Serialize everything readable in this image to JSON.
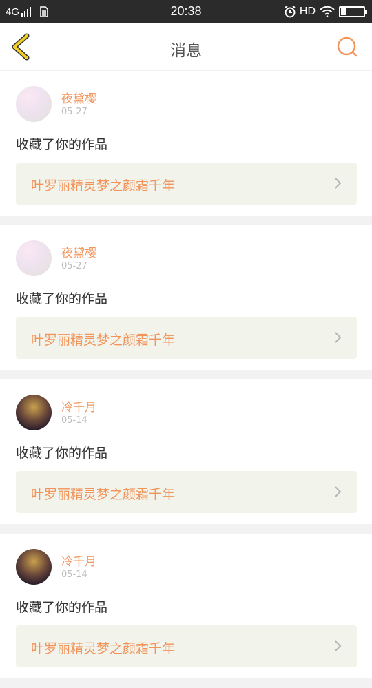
{
  "status_bar": {
    "network": "4G",
    "time": "20:38",
    "hd": "HD"
  },
  "nav": {
    "title": "消息"
  },
  "messages": [
    {
      "username": "夜黛樱",
      "date": "05-27",
      "action": "收藏了你的作品",
      "work_title": "叶罗丽精灵梦之颜霜千年",
      "avatar": "light"
    },
    {
      "username": "夜黛樱",
      "date": "05-27",
      "action": "收藏了你的作品",
      "work_title": "叶罗丽精灵梦之颜霜千年",
      "avatar": "light"
    },
    {
      "username": "冷千月",
      "date": "05-14",
      "action": "收藏了你的作品",
      "work_title": "叶罗丽精灵梦之颜霜千年",
      "avatar": "dark"
    },
    {
      "username": "冷千月",
      "date": "05-14",
      "action": "收藏了你的作品",
      "work_title": "叶罗丽精灵梦之颜霜千年",
      "avatar": "dark"
    }
  ],
  "colors": {
    "accent": "#f2935a",
    "back_arrow": "#e8c21e",
    "card_inner": "#f2f3ea"
  }
}
